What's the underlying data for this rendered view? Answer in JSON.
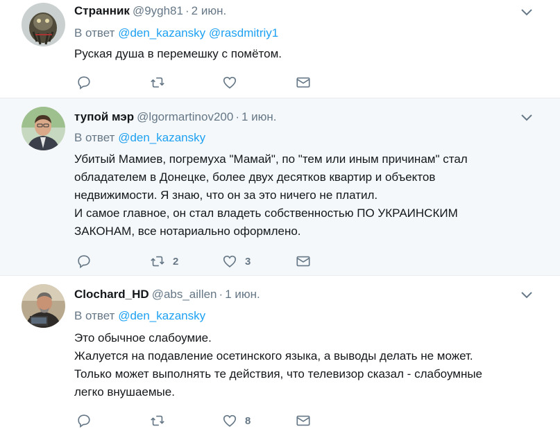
{
  "tweets": [
    {
      "name": "Странник",
      "handle": "@9ygh81",
      "date": "2 июн.",
      "reply_prefix": "В ответ",
      "mentions": [
        "@den_kazansky",
        "@rasdmitriy1"
      ],
      "text": [
        "Руская душа в перемешку с помётом."
      ],
      "retweets": "",
      "likes": ""
    },
    {
      "name": "тупой мэр",
      "handle": "@lgormartinov200",
      "date": "1 июн.",
      "reply_prefix": "В ответ",
      "mentions": [
        "@den_kazansky"
      ],
      "text": [
        "Убитый Мамиев, погремуха \"Мамай\", по \"тем или иным причинам\" стал",
        "обладателем в Донецке, более двух десятков квартир и объектов",
        "недвижимости. Я знаю, что он за это ничего не платил.",
        "И самое главное, он стал владеть собственностью ПО УКРАИНСКИМ",
        "ЗАКОНАМ, все нотариально оформлено."
      ],
      "retweets": "2",
      "likes": "3"
    },
    {
      "name": "Clochard_HD",
      "handle": "@abs_aillen",
      "date": "1 июн.",
      "reply_prefix": "В ответ",
      "mentions": [
        "@den_kazansky"
      ],
      "text": [
        "Это обычное слабоумие.",
        "Жалуется на подавление осетинского языка, а выводы делать не может.",
        "Только может выполнять те действия, что телевизор сказал - слабоумные",
        "легко внушаемые."
      ],
      "retweets": "",
      "likes": "8"
    }
  ],
  "icons": {
    "reply": "reply-icon",
    "retweet": "retweet-icon",
    "like": "heart-icon",
    "dm": "envelope-icon",
    "caret": "chevron-down-icon"
  },
  "colors": {
    "link": "#1da1f2",
    "muted": "#657786",
    "text": "#14171a",
    "highlight_bg": "#f5f8fa",
    "border": "#e6ecf0"
  }
}
